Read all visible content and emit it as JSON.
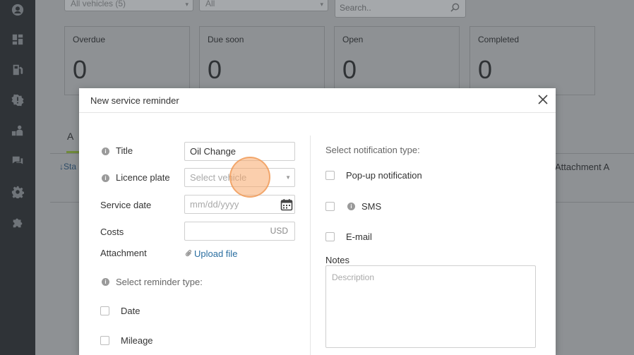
{
  "filters": {
    "vehicles": "All vehicles  (5)",
    "status": "All"
  },
  "search": {
    "placeholder": "Search.."
  },
  "stats": [
    {
      "label": "Overdue",
      "value": "0"
    },
    {
      "label": "Due soon",
      "value": "0"
    },
    {
      "label": "Open",
      "value": "0"
    },
    {
      "label": "Completed",
      "value": "0"
    }
  ],
  "background": {
    "tab_initial": "A",
    "link_text": "Sta",
    "attachment_col": "Attachment A"
  },
  "modal": {
    "title": "New service reminder",
    "left": {
      "title_label": "Title",
      "title_value": "Oil Change",
      "plate_label": "Licence plate",
      "plate_placeholder": "Select vehicle",
      "date_label": "Service date",
      "date_placeholder": "mm/dd/yyyy",
      "costs_label": "Costs",
      "costs_unit": "USD",
      "attachment_label": "Attachment",
      "upload_label": "Upload file",
      "reminder_type_label": "Select reminder type:",
      "reminder_types": [
        "Date",
        "Mileage"
      ]
    },
    "right": {
      "notification_label": "Select notification type:",
      "notifications": [
        "Pop-up notification",
        "SMS",
        "E-mail"
      ],
      "notes_label": "Notes",
      "notes_placeholder": "Description"
    }
  },
  "colors": {
    "link": "#2a6ea0",
    "cursor": "#f7a869",
    "sidebar": "#2f3337"
  }
}
